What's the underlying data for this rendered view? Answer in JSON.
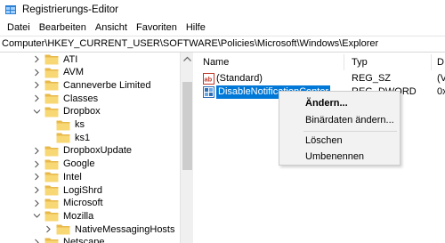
{
  "window": {
    "title": "Registrierungs-Editor",
    "icon": "regedit-icon"
  },
  "menu": [
    "Datei",
    "Bearbeiten",
    "Ansicht",
    "Favoriten",
    "Hilfe"
  ],
  "address": "Computer\\HKEY_CURRENT_USER\\SOFTWARE\\Policies\\Microsoft\\Windows\\Explorer",
  "tree": [
    {
      "label": "ATI",
      "expanded": false,
      "indent": 0
    },
    {
      "label": "AVM",
      "expanded": false,
      "indent": 0
    },
    {
      "label": "Canneverbe Limited",
      "expanded": false,
      "indent": 0
    },
    {
      "label": "Classes",
      "expanded": false,
      "indent": 0
    },
    {
      "label": "Dropbox",
      "expanded": true,
      "indent": 0
    },
    {
      "label": "ks",
      "expanded": null,
      "indent": 1
    },
    {
      "label": "ks1",
      "expanded": null,
      "indent": 1
    },
    {
      "label": "DropboxUpdate",
      "expanded": false,
      "indent": 0
    },
    {
      "label": "Google",
      "expanded": false,
      "indent": 0
    },
    {
      "label": "Intel",
      "expanded": false,
      "indent": 0
    },
    {
      "label": "LogiShrd",
      "expanded": false,
      "indent": 0
    },
    {
      "label": "Microsoft",
      "expanded": false,
      "indent": 0
    },
    {
      "label": "Mozilla",
      "expanded": true,
      "indent": 0
    },
    {
      "label": "NativeMessagingHosts",
      "expanded": false,
      "indent": 1
    },
    {
      "label": "Netscape",
      "expanded": false,
      "indent": 0
    }
  ],
  "columns": {
    "name": "Name",
    "type": "Typ",
    "data": "D"
  },
  "values": [
    {
      "name": "(Standard)",
      "type": "REG_SZ",
      "data": "(V",
      "icon": "string-value-icon"
    },
    {
      "name": "DisableNotificationCenter",
      "type": "REG_DWORD",
      "data": "0x",
      "icon": "binary-value-icon"
    }
  ],
  "context_menu": {
    "items": [
      "Ändern...",
      "Binärdaten ändern...",
      "Löschen",
      "Umbenennen"
    ]
  },
  "colors": {
    "selection": "#0078d7",
    "folder": "#f8d775",
    "folder_dark": "#e8b84a"
  }
}
